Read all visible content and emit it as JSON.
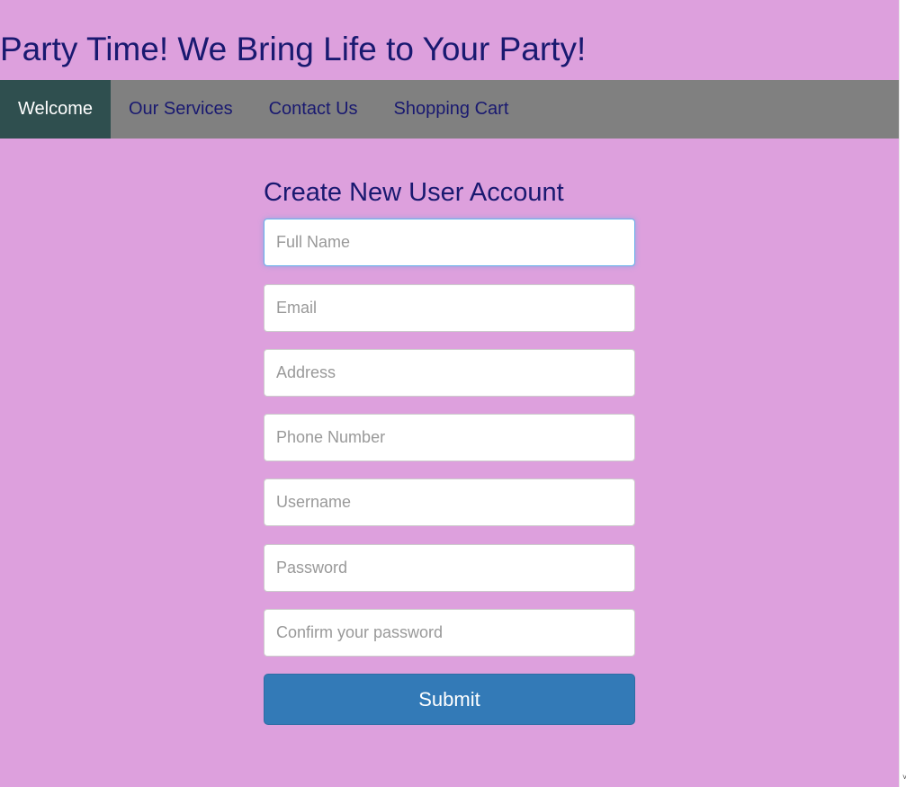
{
  "header": {
    "title": "Party Time! We Bring Life to Your Party!"
  },
  "nav": {
    "items": [
      {
        "label": "Welcome",
        "active": true
      },
      {
        "label": "Our Services",
        "active": false
      },
      {
        "label": "Contact Us",
        "active": false
      },
      {
        "label": "Shopping Cart",
        "active": false
      }
    ]
  },
  "form": {
    "title": "Create New User Account",
    "fields": {
      "full_name": {
        "placeholder": "Full Name",
        "value": "",
        "focused": true
      },
      "email": {
        "placeholder": "Email",
        "value": ""
      },
      "address": {
        "placeholder": "Address",
        "value": ""
      },
      "phone": {
        "placeholder": "Phone Number",
        "value": ""
      },
      "username": {
        "placeholder": "Username",
        "value": ""
      },
      "password": {
        "placeholder": "Password",
        "value": ""
      },
      "confirm_password": {
        "placeholder": "Confirm your password",
        "value": ""
      }
    },
    "submit_label": "Submit"
  },
  "colors": {
    "page_background": "#dda0dd",
    "heading_text": "#191970",
    "nav_background": "#808080",
    "nav_active_background": "#2f4f4f",
    "button_primary": "#337ab7"
  },
  "scrollbar": {
    "down_arrow_icon": "chevron-down-icon",
    "down_arrow_glyph": "˅"
  }
}
